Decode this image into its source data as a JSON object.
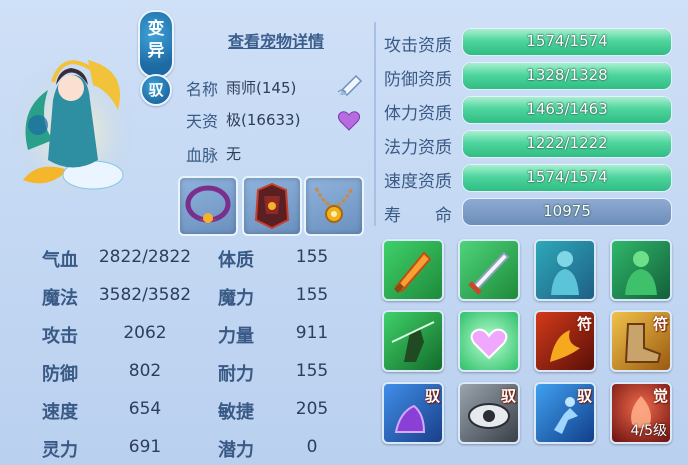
{
  "badges": {
    "variant": "变异",
    "ride": "驭"
  },
  "detail_link": "查看宠物详情",
  "info": {
    "name_label": "名称",
    "name_value": "雨师(145)",
    "talent_label": "天资",
    "talent_value": "极(16633)",
    "bloodline_label": "血脉",
    "bloodline_value": "无"
  },
  "stats": [
    {
      "label": "气血",
      "value": "2822/2822",
      "label2": "体质",
      "value2": "155"
    },
    {
      "label": "魔法",
      "value": "3582/3582",
      "label2": "魔力",
      "value2": "155"
    },
    {
      "label": "攻击",
      "value": "2062",
      "label2": "力量",
      "value2": "911"
    },
    {
      "label": "防御",
      "value": "802",
      "label2": "耐力",
      "value2": "155"
    },
    {
      "label": "速度",
      "value": "654",
      "label2": "敏捷",
      "value2": "205"
    },
    {
      "label": "灵力",
      "value": "691",
      "label2": "潜力",
      "value2": "0"
    }
  ],
  "aptitudes": [
    {
      "label": "攻击资质",
      "text": "1574/1574",
      "fill": 1.0
    },
    {
      "label": "防御资质",
      "text": "1328/1328",
      "fill": 1.0
    },
    {
      "label": "体力资质",
      "text": "1463/1463",
      "fill": 1.0
    },
    {
      "label": "法力资质",
      "text": "1222/1222",
      "fill": 1.0
    },
    {
      "label": "速度资质",
      "text": "1574/1574",
      "fill": 1.0
    }
  ],
  "life": {
    "label_a": "寿",
    "label_b": "命",
    "value": "10975"
  },
  "skills": [
    {
      "icon": "fire-sword-icon",
      "tag": ""
    },
    {
      "icon": "silver-sword-icon",
      "tag": ""
    },
    {
      "icon": "shadow-figure-icon",
      "tag": ""
    },
    {
      "icon": "green-figure-icon",
      "tag": ""
    },
    {
      "icon": "green-warrior-icon",
      "tag": ""
    },
    {
      "icon": "heart-icon",
      "tag": ""
    },
    {
      "icon": "fire-claw-icon",
      "tag": "符"
    },
    {
      "icon": "boot-icon",
      "tag": "符"
    },
    {
      "icon": "purple-claw-icon",
      "tag": "驭"
    },
    {
      "icon": "eye-icon",
      "tag": "驭"
    },
    {
      "icon": "runner-icon",
      "tag": "驭"
    },
    {
      "icon": "awaken-icon",
      "tag": "觉",
      "level": "4/5级"
    }
  ],
  "colors": {
    "bar_green": "#3fcf94",
    "background": "#c4d8f3",
    "badge_blue": "#1e6aa4"
  }
}
